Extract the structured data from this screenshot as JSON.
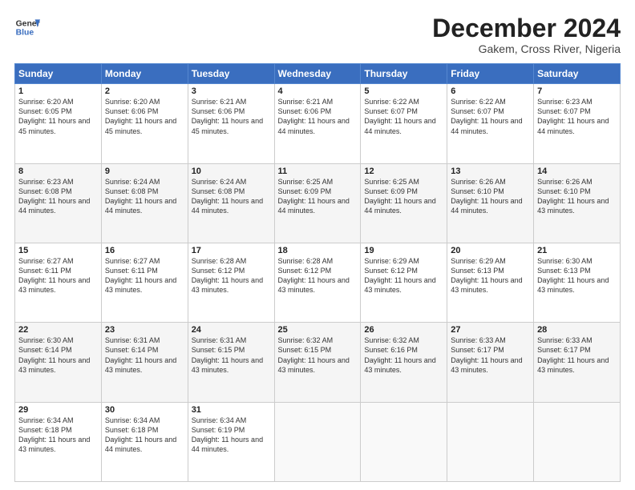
{
  "logo": {
    "line1": "General",
    "line2": "Blue"
  },
  "title": "December 2024",
  "subtitle": "Gakem, Cross River, Nigeria",
  "days_of_week": [
    "Sunday",
    "Monday",
    "Tuesday",
    "Wednesday",
    "Thursday",
    "Friday",
    "Saturday"
  ],
  "weeks": [
    [
      {
        "day": 1,
        "sunrise": "6:20 AM",
        "sunset": "6:05 PM",
        "daylight": "11 hours and 45 minutes."
      },
      {
        "day": 2,
        "sunrise": "6:20 AM",
        "sunset": "6:06 PM",
        "daylight": "11 hours and 45 minutes."
      },
      {
        "day": 3,
        "sunrise": "6:21 AM",
        "sunset": "6:06 PM",
        "daylight": "11 hours and 45 minutes."
      },
      {
        "day": 4,
        "sunrise": "6:21 AM",
        "sunset": "6:06 PM",
        "daylight": "11 hours and 44 minutes."
      },
      {
        "day": 5,
        "sunrise": "6:22 AM",
        "sunset": "6:07 PM",
        "daylight": "11 hours and 44 minutes."
      },
      {
        "day": 6,
        "sunrise": "6:22 AM",
        "sunset": "6:07 PM",
        "daylight": "11 hours and 44 minutes."
      },
      {
        "day": 7,
        "sunrise": "6:23 AM",
        "sunset": "6:07 PM",
        "daylight": "11 hours and 44 minutes."
      }
    ],
    [
      {
        "day": 8,
        "sunrise": "6:23 AM",
        "sunset": "6:08 PM",
        "daylight": "11 hours and 44 minutes."
      },
      {
        "day": 9,
        "sunrise": "6:24 AM",
        "sunset": "6:08 PM",
        "daylight": "11 hours and 44 minutes."
      },
      {
        "day": 10,
        "sunrise": "6:24 AM",
        "sunset": "6:08 PM",
        "daylight": "11 hours and 44 minutes."
      },
      {
        "day": 11,
        "sunrise": "6:25 AM",
        "sunset": "6:09 PM",
        "daylight": "11 hours and 44 minutes."
      },
      {
        "day": 12,
        "sunrise": "6:25 AM",
        "sunset": "6:09 PM",
        "daylight": "11 hours and 44 minutes."
      },
      {
        "day": 13,
        "sunrise": "6:26 AM",
        "sunset": "6:10 PM",
        "daylight": "11 hours and 44 minutes."
      },
      {
        "day": 14,
        "sunrise": "6:26 AM",
        "sunset": "6:10 PM",
        "daylight": "11 hours and 43 minutes."
      }
    ],
    [
      {
        "day": 15,
        "sunrise": "6:27 AM",
        "sunset": "6:11 PM",
        "daylight": "11 hours and 43 minutes."
      },
      {
        "day": 16,
        "sunrise": "6:27 AM",
        "sunset": "6:11 PM",
        "daylight": "11 hours and 43 minutes."
      },
      {
        "day": 17,
        "sunrise": "6:28 AM",
        "sunset": "6:12 PM",
        "daylight": "11 hours and 43 minutes."
      },
      {
        "day": 18,
        "sunrise": "6:28 AM",
        "sunset": "6:12 PM",
        "daylight": "11 hours and 43 minutes."
      },
      {
        "day": 19,
        "sunrise": "6:29 AM",
        "sunset": "6:12 PM",
        "daylight": "11 hours and 43 minutes."
      },
      {
        "day": 20,
        "sunrise": "6:29 AM",
        "sunset": "6:13 PM",
        "daylight": "11 hours and 43 minutes."
      },
      {
        "day": 21,
        "sunrise": "6:30 AM",
        "sunset": "6:13 PM",
        "daylight": "11 hours and 43 minutes."
      }
    ],
    [
      {
        "day": 22,
        "sunrise": "6:30 AM",
        "sunset": "6:14 PM",
        "daylight": "11 hours and 43 minutes."
      },
      {
        "day": 23,
        "sunrise": "6:31 AM",
        "sunset": "6:14 PM",
        "daylight": "11 hours and 43 minutes."
      },
      {
        "day": 24,
        "sunrise": "6:31 AM",
        "sunset": "6:15 PM",
        "daylight": "11 hours and 43 minutes."
      },
      {
        "day": 25,
        "sunrise": "6:32 AM",
        "sunset": "6:15 PM",
        "daylight": "11 hours and 43 minutes."
      },
      {
        "day": 26,
        "sunrise": "6:32 AM",
        "sunset": "6:16 PM",
        "daylight": "11 hours and 43 minutes."
      },
      {
        "day": 27,
        "sunrise": "6:33 AM",
        "sunset": "6:17 PM",
        "daylight": "11 hours and 43 minutes."
      },
      {
        "day": 28,
        "sunrise": "6:33 AM",
        "sunset": "6:17 PM",
        "daylight": "11 hours and 43 minutes."
      }
    ],
    [
      {
        "day": 29,
        "sunrise": "6:34 AM",
        "sunset": "6:18 PM",
        "daylight": "11 hours and 43 minutes."
      },
      {
        "day": 30,
        "sunrise": "6:34 AM",
        "sunset": "6:18 PM",
        "daylight": "11 hours and 44 minutes."
      },
      {
        "day": 31,
        "sunrise": "6:34 AM",
        "sunset": "6:19 PM",
        "daylight": "11 hours and 44 minutes."
      },
      null,
      null,
      null,
      null
    ]
  ]
}
